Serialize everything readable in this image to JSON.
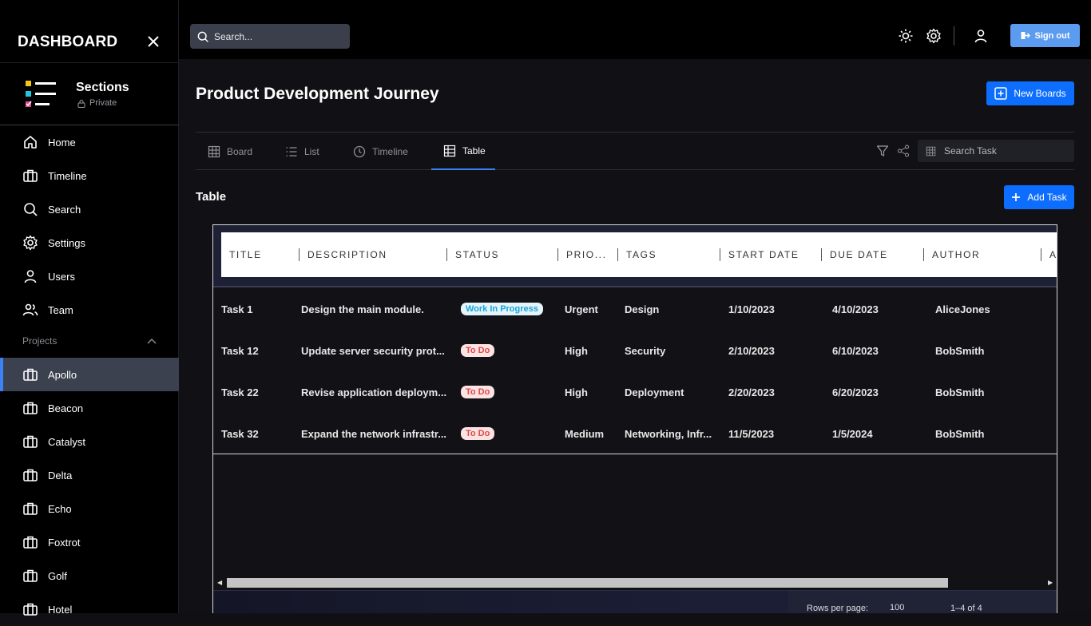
{
  "app": {
    "brand": "DASHBOARD"
  },
  "workspace": {
    "name": "Sections",
    "visibility": "Private"
  },
  "nav": {
    "items": [
      {
        "label": "Home",
        "icon": "home-icon"
      },
      {
        "label": "Timeline",
        "icon": "briefcase-icon"
      },
      {
        "label": "Search",
        "icon": "search-icon"
      },
      {
        "label": "Settings",
        "icon": "gear-icon"
      },
      {
        "label": "Users",
        "icon": "user-icon"
      },
      {
        "label": "Team",
        "icon": "users-icon"
      }
    ],
    "projects_label": "Projects",
    "projects": [
      "Apollo",
      "Beacon",
      "Catalyst",
      "Delta",
      "Echo",
      "Foxtrot",
      "Golf",
      "Hotel"
    ],
    "active_project": "Apollo"
  },
  "topbar": {
    "search_placeholder": "Search...",
    "sign_out_label": "Sign out"
  },
  "page": {
    "title": "Product Development Journey",
    "new_boards_label": "New Boards",
    "section_title": "Table",
    "add_task_label": "Add Task"
  },
  "tabs": [
    {
      "label": "Board",
      "icon": "grid-icon"
    },
    {
      "label": "List",
      "icon": "list-icon"
    },
    {
      "label": "Timeline",
      "icon": "clock-icon"
    },
    {
      "label": "Table",
      "icon": "table-icon"
    }
  ],
  "active_tab": "Table",
  "search_task_placeholder": "Search Task",
  "table": {
    "columns": [
      "TITLE",
      "DESCRIPTION",
      "STATUS",
      "PRIO...",
      "TAGS",
      "START DATE",
      "DUE DATE",
      "AUTHOR",
      "A"
    ],
    "rows": [
      {
        "title": "Task 1",
        "description": "Design the main module.",
        "status": "Work In Progress",
        "priority": "Urgent",
        "tags": "Design",
        "start": "1/10/2023",
        "due": "4/10/2023",
        "author": "AliceJones"
      },
      {
        "title": "Task 12",
        "description": "Update server security prot...",
        "status": "To Do",
        "priority": "High",
        "tags": "Security",
        "start": "2/10/2023",
        "due": "6/10/2023",
        "author": "BobSmith"
      },
      {
        "title": "Task 22",
        "description": "Revise application deploym...",
        "status": "To Do",
        "priority": "High",
        "tags": "Deployment",
        "start": "2/20/2023",
        "due": "6/20/2023",
        "author": "BobSmith"
      },
      {
        "title": "Task 32",
        "description": "Expand the network infrastr...",
        "status": "To Do",
        "priority": "Medium",
        "tags": "Networking, Infr...",
        "start": "11/5/2023",
        "due": "1/5/2024",
        "author": "BobSmith"
      }
    ],
    "rows_per_page_label": "Rows per page:",
    "rows_per_page": "100",
    "page_range": "1–4 of 4"
  },
  "colors": {
    "accent": "#0d6efd",
    "active_nav": "#3c4150",
    "wip": "#1aa3d8",
    "todo": "#e24848"
  }
}
